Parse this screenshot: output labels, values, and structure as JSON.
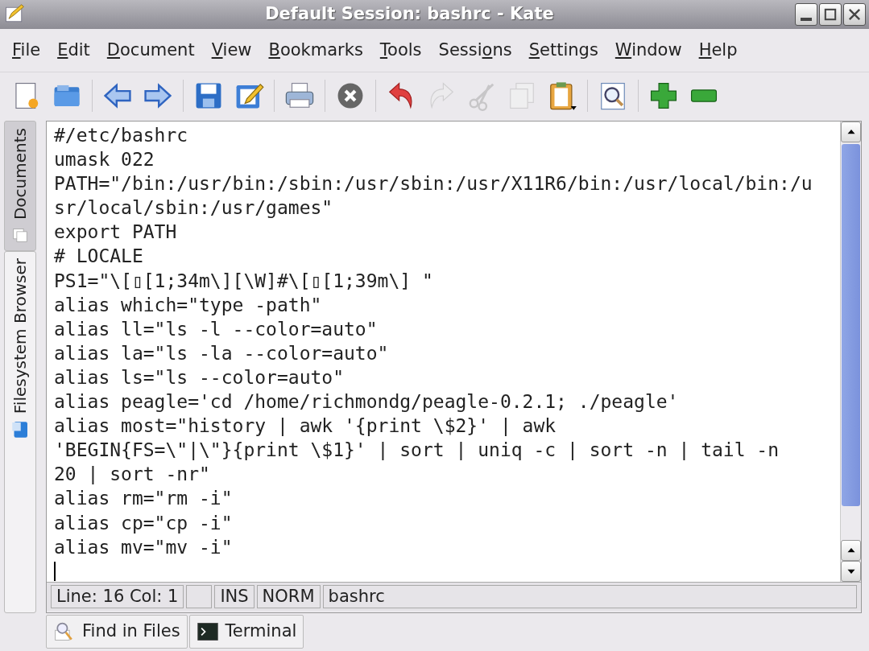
{
  "window": {
    "title": "Default Session: bashrc - Kate"
  },
  "menu": [
    {
      "key": "F",
      "after": "ile"
    },
    {
      "key": "E",
      "after": "dit"
    },
    {
      "key": "D",
      "after": "ocument"
    },
    {
      "key": "V",
      "after": "iew"
    },
    {
      "key": "B",
      "after": "ookmarks"
    },
    {
      "key": "T",
      "after": "ools"
    },
    {
      "before": "Sessi",
      "key": "o",
      "after": "ns"
    },
    {
      "key": "S",
      "after": "ettings"
    },
    {
      "key": "W",
      "after": "indow"
    },
    {
      "key": "H",
      "after": "elp"
    }
  ],
  "toolbar": [
    {
      "kind": "new",
      "disabled": false
    },
    {
      "kind": "open",
      "disabled": false
    },
    {
      "kind": "sep"
    },
    {
      "kind": "back",
      "disabled": false
    },
    {
      "kind": "forward",
      "disabled": false
    },
    {
      "kind": "sep"
    },
    {
      "kind": "save",
      "disabled": false
    },
    {
      "kind": "saveas",
      "disabled": false
    },
    {
      "kind": "sep"
    },
    {
      "kind": "print",
      "disabled": false
    },
    {
      "kind": "sep"
    },
    {
      "kind": "close",
      "disabled": false
    },
    {
      "kind": "sep"
    },
    {
      "kind": "undo",
      "disabled": false
    },
    {
      "kind": "redo",
      "disabled": true
    },
    {
      "kind": "cut",
      "disabled": true
    },
    {
      "kind": "copy",
      "disabled": true
    },
    {
      "kind": "paste",
      "disabled": false
    },
    {
      "kind": "sep"
    },
    {
      "kind": "find",
      "disabled": false
    },
    {
      "kind": "sep"
    },
    {
      "kind": "zoomin",
      "disabled": false
    },
    {
      "kind": "zoomout",
      "disabled": false
    }
  ],
  "side_tabs": [
    {
      "label": "Documents",
      "kind": "documents",
      "selected": true
    },
    {
      "label": "Filesystem Browser",
      "kind": "filesystem",
      "selected": false
    }
  ],
  "editor": {
    "lines": [
      "#/etc/bashrc",
      "umask 022",
      "PATH=\"/bin:/usr/bin:/sbin:/usr/sbin:/usr/X11R6/bin:/usr/local/bin:/u",
      "sr/local/sbin:/usr/games\"",
      "export PATH",
      "# LOCALE",
      "PS1=\"\\[▯[1;34m\\][\\W]#\\[▯[1;39m\\] \"",
      "alias which=\"type -path\"",
      "alias ll=\"ls -l --color=auto\"",
      "alias la=\"ls -la --color=auto\"",
      "alias ls=\"ls --color=auto\"",
      "alias peagle='cd /home/richmondg/peagle-0.2.1; ./peagle'",
      "alias most=\"history | awk '{print \\$2}' | awk",
      "'BEGIN{FS=\\\"|\\\"}{print \\$1}' | sort | uniq -c | sort -n | tail -n",
      "20 | sort -nr\"",
      "alias rm=\"rm -i\"",
      "alias cp=\"cp -i\"",
      "alias mv=\"mv -i\""
    ]
  },
  "status_bar": [
    {
      "kind": "text",
      "text": "Line: 16 Col: 1"
    },
    {
      "kind": "blank"
    },
    {
      "kind": "text",
      "text": "INS"
    },
    {
      "kind": "text",
      "text": "NORM"
    },
    {
      "kind": "text",
      "text": "bashrc"
    }
  ],
  "bottom_tabs": [
    {
      "label": "Find in Files",
      "kind": "find"
    },
    {
      "label": "Terminal",
      "kind": "terminal"
    }
  ]
}
